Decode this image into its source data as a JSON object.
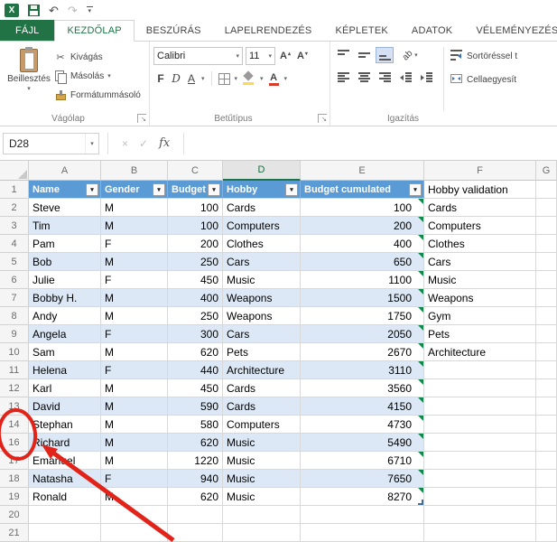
{
  "colors": {
    "excel_green": "#217346",
    "table_header_blue": "#5b9bd5",
    "band_blue": "#dce8f5",
    "annotation_red": "#e2231a",
    "error_indicator_green": "#11864a"
  },
  "icons": {
    "dropdown": "▾",
    "cut": "✂",
    "undo": "↶",
    "redo": "↷",
    "dialog_launcher": "↘",
    "up": "▴",
    "down": "▾",
    "excel_logo": "X"
  },
  "ribbon": {
    "tabs": [
      {
        "label": "FÁJL"
      },
      {
        "label": "KEZDŐLAP"
      },
      {
        "label": "BESZÚRÁS"
      },
      {
        "label": "LAPELRENDEZÉS"
      },
      {
        "label": "KÉPLETEK"
      },
      {
        "label": "ADATOK"
      },
      {
        "label": "VÉLEMÉNYEZÉS"
      }
    ],
    "clipboard": {
      "label": "Vágólap",
      "paste": "Beillesztés",
      "cut": "Kivágás",
      "copy": "Másolás",
      "format_painter": "Formátummásoló"
    },
    "font": {
      "label": "Betűtípus",
      "font_name": "Calibri",
      "font_size": "11",
      "bold": "F",
      "italic": "D",
      "underline": "A",
      "grow": "A",
      "shrink": "A",
      "font_color": "A"
    },
    "alignment": {
      "label": "Igazítás",
      "orientation": "ab",
      "wrap_text": "Sortöréssel t",
      "merge_center": "Cellaegyesít"
    }
  },
  "formula_bar": {
    "name_box": "D28",
    "cancel": "×",
    "enter": "✓",
    "fx": "fx",
    "formula": ""
  },
  "sheet": {
    "column_letters": [
      "A",
      "B",
      "C",
      "D",
      "E",
      "F",
      "G"
    ],
    "selected_column": "D",
    "rows": [
      {
        "n": 1,
        "kind": "table_header",
        "cells": {
          "name": "Name",
          "gender": "Gender",
          "budget": "Budget",
          "hobby": "Hobby",
          "cum": "Budget cumulated",
          "extra": "Hobby validation"
        }
      },
      {
        "n": 2,
        "kind": "data",
        "name": "Steve",
        "gender": "M",
        "budget": "100",
        "hobby": "Cards",
        "cum": "100",
        "extra": "Cards",
        "band": false
      },
      {
        "n": 3,
        "kind": "data",
        "name": "Tim",
        "gender": "M",
        "budget": "100",
        "hobby": "Computers",
        "cum": "200",
        "extra": "Computers",
        "band": true
      },
      {
        "n": 4,
        "kind": "data",
        "name": "Pam",
        "gender": "F",
        "budget": "200",
        "hobby": "Clothes",
        "cum": "400",
        "extra": "Clothes",
        "band": false
      },
      {
        "n": 5,
        "kind": "data",
        "name": "Bob",
        "gender": "M",
        "budget": "250",
        "hobby": "Cars",
        "cum": "650",
        "extra": "Cars",
        "band": true
      },
      {
        "n": 6,
        "kind": "data",
        "name": "Julie",
        "gender": "F",
        "budget": "450",
        "hobby": "Music",
        "cum": "1100",
        "extra": "Music",
        "band": false
      },
      {
        "n": 7,
        "kind": "data",
        "name": "Bobby H.",
        "gender": "M",
        "budget": "400",
        "hobby": "Weapons",
        "cum": "1500",
        "extra": "Weapons",
        "band": true
      },
      {
        "n": 8,
        "kind": "data",
        "name": "Andy",
        "gender": "M",
        "budget": "250",
        "hobby": "Weapons",
        "cum": "1750",
        "extra": "Gym",
        "band": false
      },
      {
        "n": 9,
        "kind": "data",
        "name": "Angela",
        "gender": "F",
        "budget": "300",
        "hobby": "Cars",
        "cum": "2050",
        "extra": "Pets",
        "band": true
      },
      {
        "n": 10,
        "kind": "data",
        "name": "Sam",
        "gender": "M",
        "budget": "620",
        "hobby": "Pets",
        "cum": "2670",
        "extra": "Architecture",
        "band": false
      },
      {
        "n": 11,
        "kind": "data",
        "name": "Helena",
        "gender": "F",
        "budget": "440",
        "hobby": "Architecture",
        "cum": "3110",
        "extra": "",
        "band": true
      },
      {
        "n": 12,
        "kind": "data",
        "name": "Karl",
        "gender": "M",
        "budget": "450",
        "hobby": "Cards",
        "cum": "3560",
        "extra": "",
        "band": false
      },
      {
        "n": 13,
        "kind": "data",
        "name": "David",
        "gender": "M",
        "budget": "590",
        "hobby": "Cards",
        "cum": "4150",
        "extra": "",
        "band": true
      },
      {
        "n": 14,
        "kind": "data",
        "name": "Stephan",
        "gender": "M",
        "budget": "580",
        "hobby": "Computers",
        "cum": "4730",
        "extra": "",
        "band": false
      },
      {
        "n": 16,
        "kind": "data",
        "name": "Richard",
        "gender": "M",
        "budget": "620",
        "hobby": "Music",
        "cum": "5490",
        "extra": "",
        "band": true
      },
      {
        "n": 17,
        "kind": "data",
        "name": "Emanuel",
        "gender": "M",
        "budget": "1220",
        "hobby": "Music",
        "cum": "6710",
        "extra": "",
        "band": false
      },
      {
        "n": 18,
        "kind": "data",
        "name": "Natasha",
        "gender": "F",
        "budget": "940",
        "hobby": "Music",
        "cum": "7650",
        "extra": "",
        "band": true
      },
      {
        "n": 19,
        "kind": "data",
        "name": "Ronald",
        "gender": "M",
        "budget": "620",
        "hobby": "Music",
        "cum": "8270",
        "extra": "",
        "band": false
      },
      {
        "n": 20,
        "kind": "empty"
      },
      {
        "n": 21,
        "kind": "empty"
      }
    ]
  }
}
